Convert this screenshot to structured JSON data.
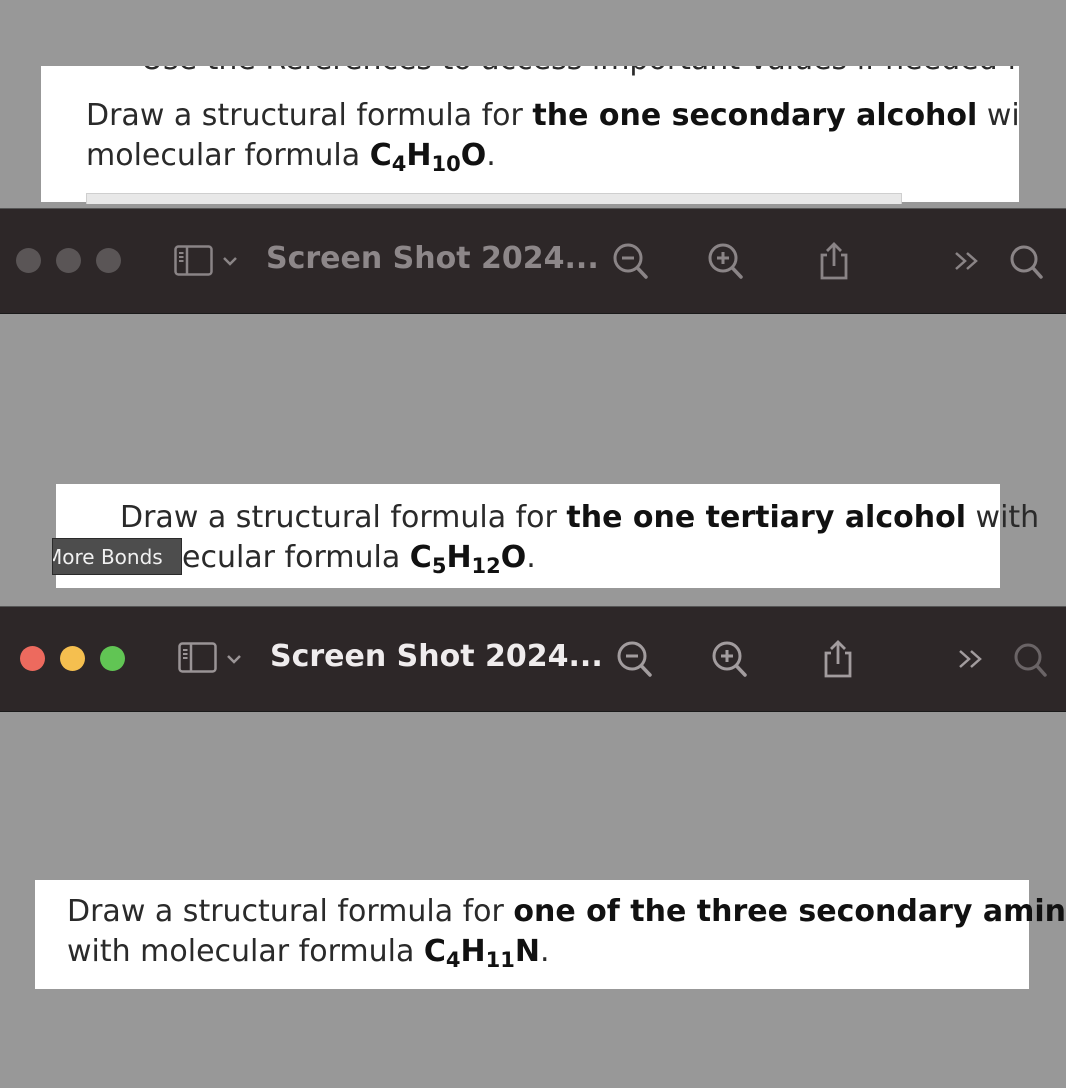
{
  "panel1": {
    "cutoff_text": "Use the References to access important values if needed for this question.",
    "line1_prefix": "Draw a structural formula for ",
    "line1_bold": "the one secondary alcohol",
    "line1_suffix": " with",
    "line2_prefix": "molecular formula ",
    "f_c": "C",
    "f_c_sub": "4",
    "f_h": "H",
    "f_h_sub": "10",
    "f_o": "O",
    "line2_suffix": "."
  },
  "toolbar1": {
    "title": "Screen Shot 2024...",
    "active": false
  },
  "panel2": {
    "line1_prefix": "Draw a structural formula for ",
    "line1_bold": "the one tertiary alcohol",
    "line1_suffix": " with",
    "line2_prefix": "ecular formula ",
    "f_c": "C",
    "f_c_sub": "5",
    "f_h": "H",
    "f_h_sub": "12",
    "f_o": "O",
    "line2_suffix": ".",
    "tooltip": "More Bonds"
  },
  "toolbar2": {
    "title": "Screen Shot 2024...",
    "active": true
  },
  "panel3": {
    "line1_prefix": "Draw a structural formula for ",
    "line1_bold": "one of the three secondary amines",
    "line2_prefix": "with molecular formula ",
    "f_c": "C",
    "f_c_sub": "4",
    "f_h": "H",
    "f_h_sub": "11",
    "f_n": "N",
    "line2_suffix": "."
  },
  "colors": {
    "background": "#989898",
    "toolbar": "#2d2728",
    "traffic_red": "#ed6a5e",
    "traffic_yellow": "#f5bf4f",
    "traffic_green": "#61c554",
    "traffic_inactive": "#5a5556"
  }
}
